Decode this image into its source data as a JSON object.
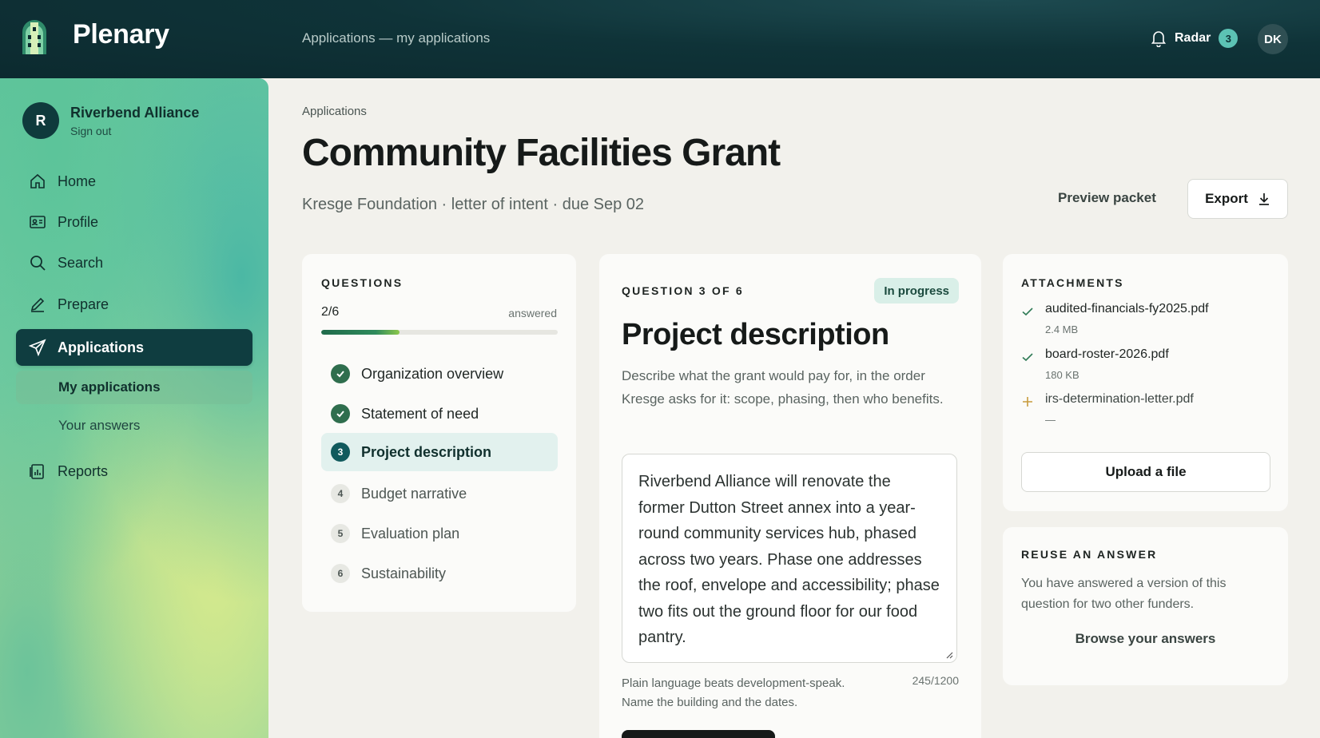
{
  "app": {
    "brand": "Plenary",
    "breadcrumb": "Applications — my applications",
    "radar_label": "Radar",
    "radar_count": "3",
    "user_initials": "DK",
    "colors": {
      "topbar": "#0f3338",
      "accent": "#0f3d40",
      "success": "#2f6e4e"
    }
  },
  "sidebar": {
    "org_initial": "R",
    "org_name": "Riverbend Alliance",
    "sign_out": "Sign out",
    "items": [
      {
        "label": "Home",
        "icon": "home-icon"
      },
      {
        "label": "Profile",
        "icon": "id-card-icon"
      },
      {
        "label": "Search",
        "icon": "search-icon"
      },
      {
        "label": "Prepare",
        "icon": "pencil-icon"
      },
      {
        "label": "Applications",
        "icon": "send-icon",
        "active": true
      },
      {
        "label": "Reports",
        "icon": "report-icon"
      }
    ],
    "subitems": [
      {
        "label": "My applications",
        "active": true
      },
      {
        "label": "Your answers",
        "active": false
      }
    ]
  },
  "page": {
    "breadcrumb": "Applications",
    "title": "Community Facilities Grant",
    "subtitle": "Kresge Foundation · letter of intent · due Sep 02",
    "preview_label": "Preview packet",
    "export_label": "Export"
  },
  "questions": {
    "label": "QUESTIONS",
    "count": "2/6",
    "answered_label": "answered",
    "progress": 0.33,
    "items": [
      {
        "num": "1",
        "label": "Organization overview",
        "state": "done"
      },
      {
        "num": "2",
        "label": "Statement of need",
        "state": "done"
      },
      {
        "num": "3",
        "label": "Project description",
        "state": "current"
      },
      {
        "num": "4",
        "label": "Budget narrative",
        "state": "todo"
      },
      {
        "num": "5",
        "label": "Evaluation plan",
        "state": "todo"
      },
      {
        "num": "6",
        "label": "Sustainability",
        "state": "todo"
      }
    ]
  },
  "question": {
    "label": "QUESTION 3 OF 6",
    "status": "In progress",
    "title": "Project description",
    "description": "Describe what the grant would pay for, in the order Kresge asks for it: scope, phasing, then who benefits.",
    "answer": "Riverbend Alliance will renovate the former Dutton Street annex into a year-round community services hub, phased across two years. Phase one addresses the roof, envelope and accessibility; phase two fits out the ground floor for our food pantry.",
    "hint": "Plain language beats development-speak. Name the building and the dates.",
    "char_count": "245/1200"
  },
  "attachments": {
    "label": "ATTACHMENTS",
    "items": [
      {
        "name": "audited-financials-fy2025.pdf",
        "size": "2.4 MB",
        "state": "uploaded"
      },
      {
        "name": "board-roster-2026.pdf",
        "size": "180 KB",
        "state": "uploaded"
      },
      {
        "name": "irs-determination-letter.pdf",
        "size": "—",
        "state": "missing"
      }
    ],
    "upload_label": "Upload a file"
  },
  "reuse": {
    "label": "REUSE AN ANSWER",
    "text": "You have answered a version of this question for two other funders.",
    "link": "Browse your answers"
  }
}
